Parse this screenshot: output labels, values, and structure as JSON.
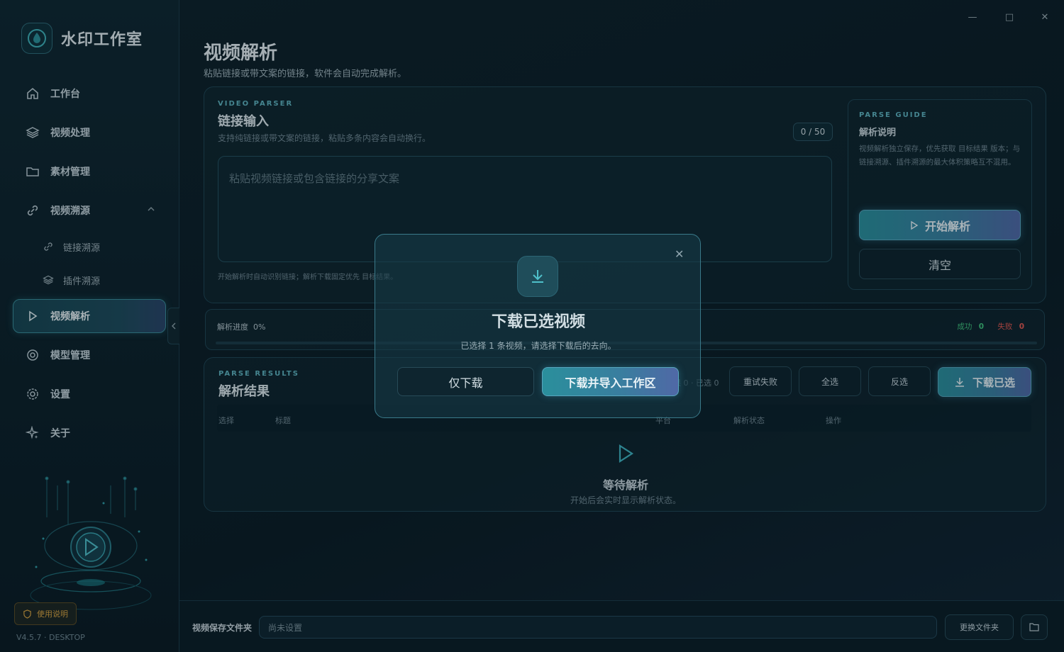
{
  "app": {
    "name": "水印工作室",
    "version": "V4.5.7 · DESKTOP"
  },
  "window": {
    "minimize": "—",
    "maximize": "□",
    "close": "✕"
  },
  "sidebar": {
    "items": [
      {
        "label": "工作台",
        "icon": "home-icon"
      },
      {
        "label": "视频处理",
        "icon": "layers-icon"
      },
      {
        "label": "素材管理",
        "icon": "folder-icon"
      },
      {
        "label": "视频溯源",
        "icon": "link-icon",
        "expanded": true,
        "children": [
          {
            "label": "链接溯源",
            "icon": "link-icon"
          },
          {
            "label": "插件溯源",
            "icon": "layers-icon"
          }
        ]
      },
      {
        "label": "视频解析",
        "icon": "play-icon",
        "active": true
      },
      {
        "label": "模型管理",
        "icon": "gear-icon"
      },
      {
        "label": "设置",
        "icon": "settings-icon"
      },
      {
        "label": "关于",
        "icon": "sparkle-icon"
      }
    ],
    "help_label": "使用说明"
  },
  "page": {
    "title": "视频解析",
    "subtitle": "粘贴链接或带文案的链接，软件会自动完成解析。"
  },
  "parser": {
    "eyebrow": "VIDEO PARSER",
    "title": "链接输入",
    "desc": "支持纯链接或带文案的链接，粘贴多条内容会自动换行。",
    "counter": "0 / 50",
    "placeholder": "粘贴视频链接或包含链接的分享文案",
    "hint": "开始解析时自动识别链接；解析下载固定优先 目标结果。"
  },
  "guide": {
    "eyebrow": "PARSE GUIDE",
    "title": "解析说明",
    "text": "视频解析独立保存，优先获取 目标结果 版本；与链接溯源、插件溯源的最大体积策略互不混用。",
    "start_label": "开始解析",
    "clear_label": "清空"
  },
  "progress": {
    "label": "解析进度",
    "value": "0%",
    "percent": 0,
    "success_label": "成功",
    "success_count": "0",
    "fail_label": "失败",
    "fail_count": "0",
    "colors": {
      "success": "#3fc07a",
      "fail": "#e2564f"
    }
  },
  "results": {
    "eyebrow": "PARSE RESULTS",
    "title": "解析结果",
    "counts": "结果 0 · 已选 0",
    "actions": {
      "retry": "重试失败",
      "select_all": "全选",
      "invert": "反选",
      "download": "下载已选"
    },
    "columns": [
      "选择",
      "标题",
      "平台",
      "解析状态",
      "操作"
    ],
    "empty_title": "等待解析",
    "empty_sub": "开始后会实时显示解析状态。"
  },
  "footer": {
    "label": "视频保存文件夹",
    "folder_value": "尚未设置",
    "change_label": "更换文件夹"
  },
  "dialog": {
    "title": "下载已选视频",
    "sub": "已选择 1 条视频，请选择下载后的去向。",
    "download_only": "仅下载",
    "download_import": "下载并导入工作区",
    "close": "✕"
  }
}
